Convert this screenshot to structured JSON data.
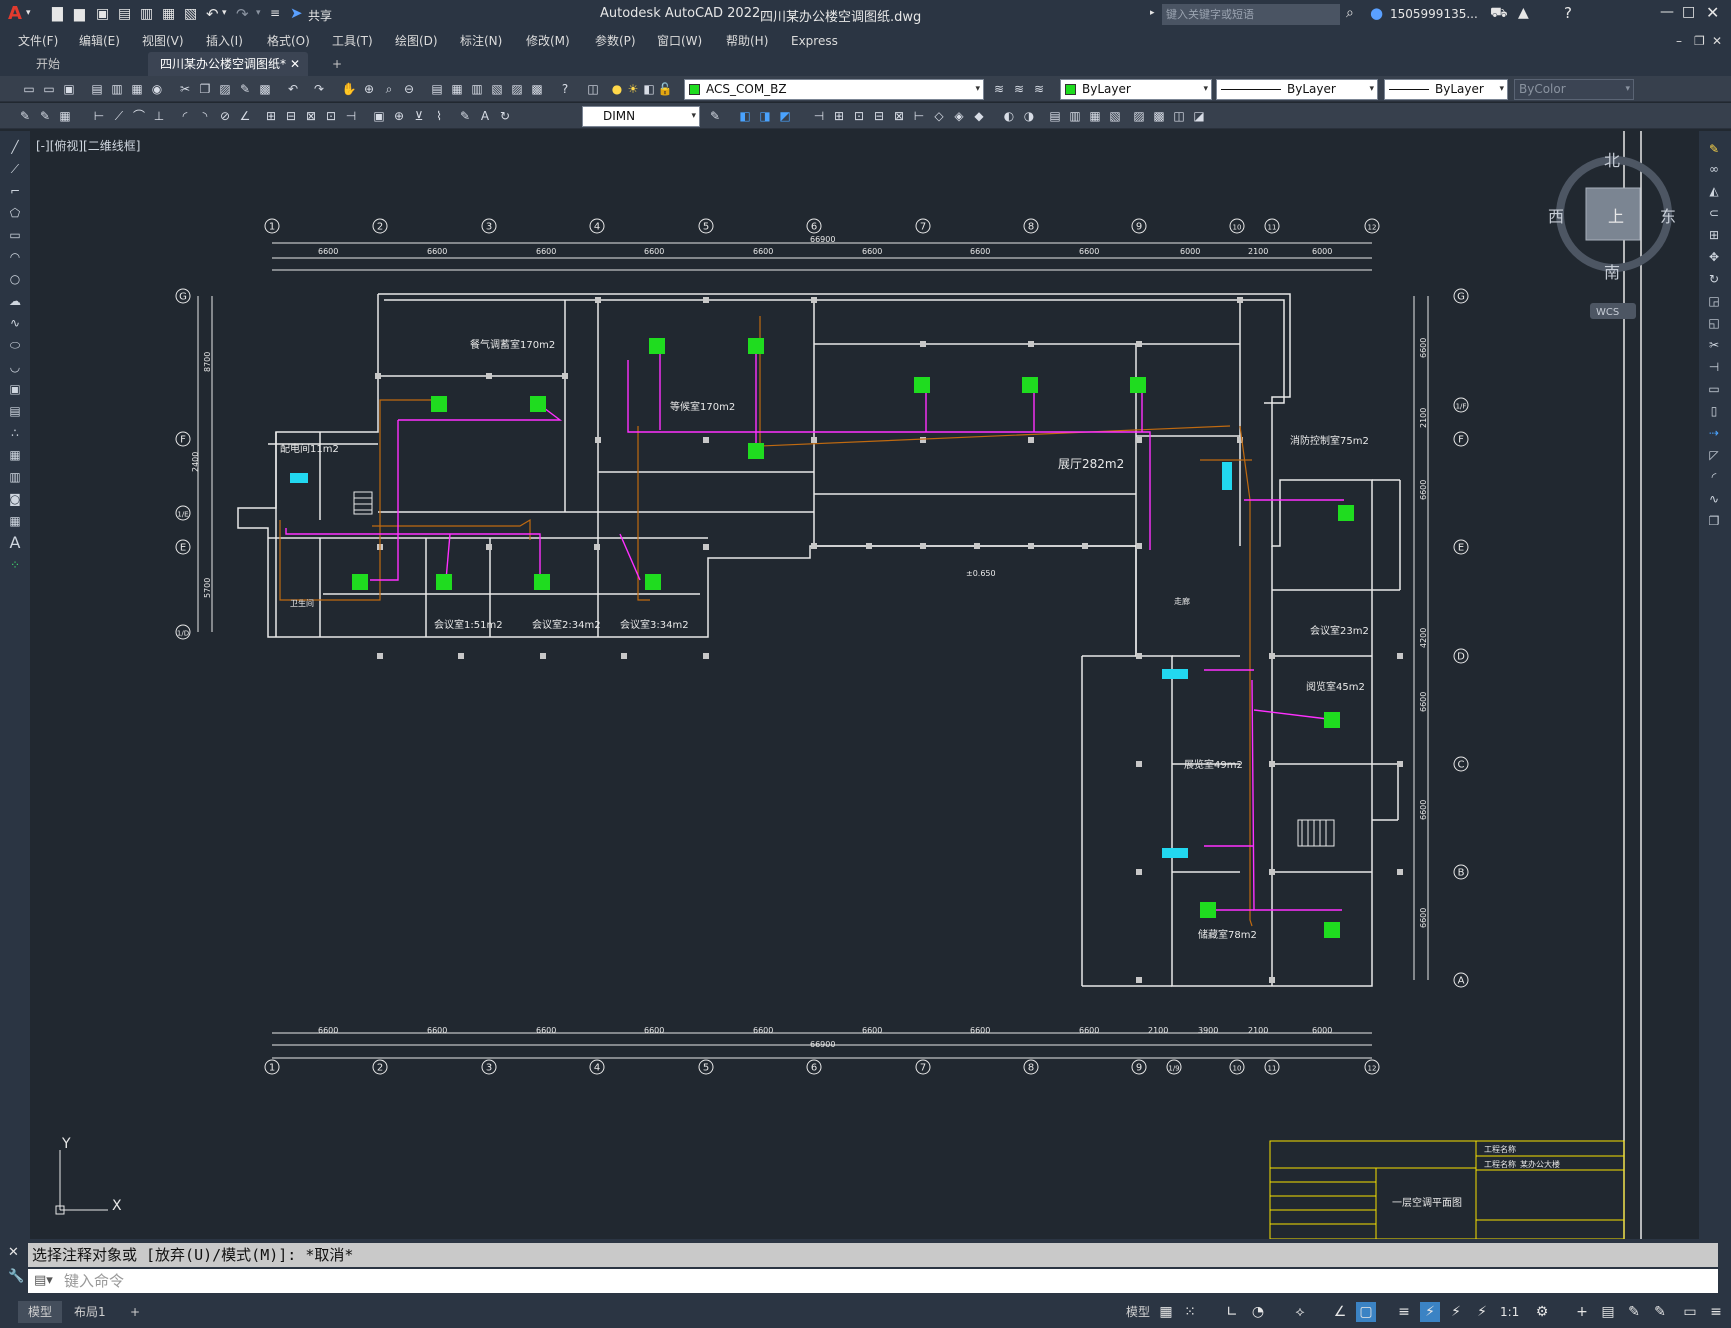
{
  "app": {
    "logo": "A",
    "title": "Autodesk AutoCAD 2022",
    "document": "四川某办公楼空调图纸.dwg",
    "share_label": "共享",
    "search_placeholder": "键入关键字或短语",
    "user": "1505999135..."
  },
  "menu": [
    "文件(F)",
    "编辑(E)",
    "视图(V)",
    "插入(I)",
    "格式(O)",
    "工具(T)",
    "绘图(D)",
    "标注(N)",
    "修改(M)",
    "参数(P)",
    "窗口(W)",
    "帮助(H)",
    "Express"
  ],
  "tabs": {
    "start": "开始",
    "drawing": "四川某办公楼空调图纸*",
    "add": "+"
  },
  "layer_combo": {
    "value": "ACS_COM_BZ"
  },
  "color_combo": {
    "value": "ByLayer"
  },
  "linetype_combo": {
    "value": "ByLayer"
  },
  "lineweight_combo": {
    "value": "ByLayer"
  },
  "plotstyle_combo": {
    "value": "ByColor"
  },
  "dimstyle_combo": {
    "value": "DIMN"
  },
  "viewport_label": "[-][俯视][二维线框]",
  "viewcube": {
    "north": "北",
    "south": "南",
    "east": "东",
    "west": "西",
    "top": "上",
    "wcs": "WCS"
  },
  "drawing": {
    "grid_top": [
      "1",
      "2",
      "3",
      "4",
      "5",
      "6",
      "7",
      "8",
      "9",
      "10",
      "11",
      "12"
    ],
    "grid_bottom": [
      "1",
      "2",
      "3",
      "4",
      "5",
      "6",
      "7",
      "8",
      "9",
      "1/9",
      "10",
      "11",
      "12"
    ],
    "grid_left": [
      "G",
      "F",
      "1/E",
      "E",
      "1/D"
    ],
    "grid_right": [
      "G",
      "1/F",
      "F",
      "E",
      "D",
      "C",
      "B",
      "A"
    ],
    "dims_top": [
      "6600",
      "6600",
      "6600",
      "6600",
      "6600",
      "6600",
      "6600",
      "6600",
      "6000",
      "2100",
      "6000"
    ],
    "dim_total_top": "66900",
    "dims_bottom": [
      "6600",
      "6600",
      "6600",
      "6600",
      "6600",
      "6600",
      "6600",
      "6600",
      "2100",
      "3900",
      "2100",
      "6000"
    ],
    "dim_total_bottom": "66900",
    "dims_left": [
      "8700",
      "2400",
      "5700"
    ],
    "dims_right": [
      "6600",
      "2100",
      "6600",
      "4200",
      "6600",
      "6600",
      "6600"
    ],
    "rooms": [
      "餐气调蓄室170m2",
      "等候室170m2",
      "配电间11m2",
      "展厅282m2",
      "消防控制室75m2",
      "会议室1:51m2",
      "会议室2:34m2",
      "会议室3:34m2",
      "卫生间",
      "会议室23m2",
      "阅览室45m2",
      "展览室49m2",
      "储藏室78m2",
      "走廊"
    ],
    "elevation": "±0.650"
  },
  "titleblock": {
    "drawing_name": "一层空调平面图",
    "project_label": "工程名称",
    "project_value": "某办公大楼"
  },
  "command": {
    "history": "选择注释对象或 [放弃(U)/模式(M)]: *取消*",
    "placeholder": "键入命令"
  },
  "status": {
    "model": "模型",
    "layout": "布局1",
    "add": "+",
    "model_btn": "模型",
    "scale": "1:1"
  },
  "colors": {
    "ac_unit": "#1fdc1f",
    "pipe": "#ff30ff",
    "refrigerant": "#c06a10",
    "wall": "#e8e8e8",
    "cassette": "#22d8f0",
    "titleblock": "#f7e000"
  }
}
